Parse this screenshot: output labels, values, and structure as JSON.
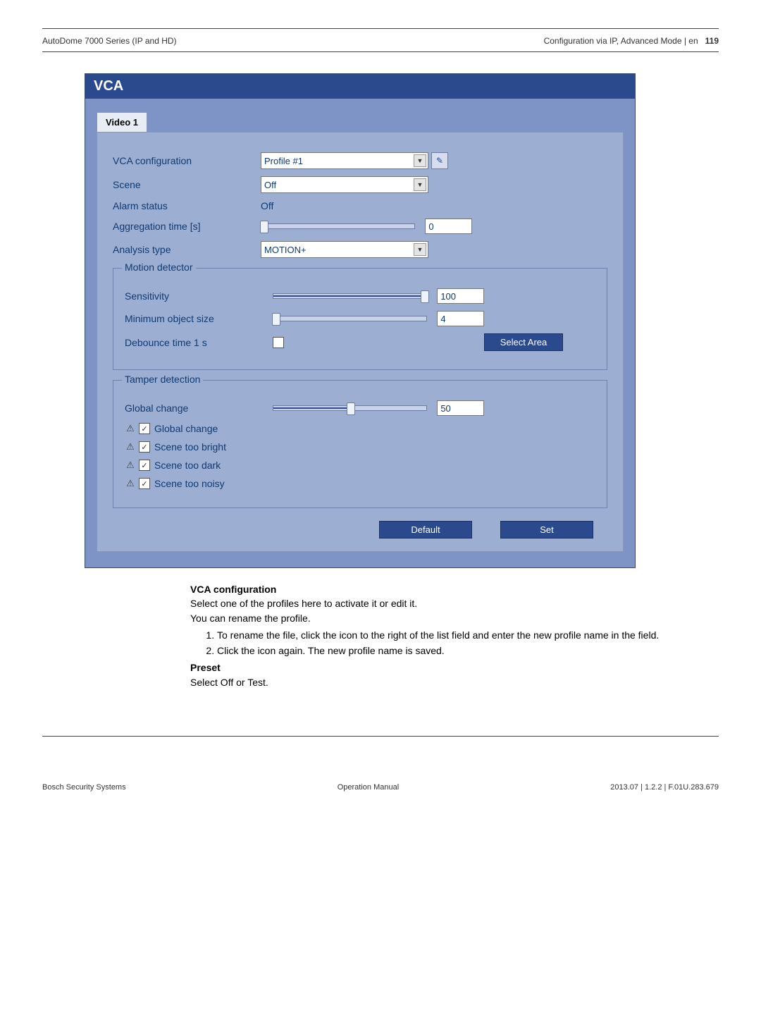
{
  "header": {
    "product": "AutoDome 7000 Series (IP and HD)",
    "section": "Configuration via IP, Advanced Mode | en",
    "page": "119"
  },
  "panel": {
    "title": "VCA",
    "tab": "Video 1",
    "rows": {
      "vca_config": {
        "label": "VCA configuration",
        "value": "Profile #1"
      },
      "scene": {
        "label": "Scene",
        "value": "Off"
      },
      "alarm_status": {
        "label": "Alarm status",
        "value": "Off"
      },
      "aggregation": {
        "label": "Aggregation time [s]",
        "value": "0"
      },
      "analysis_type": {
        "label": "Analysis type",
        "value": "MOTION+"
      }
    },
    "motion": {
      "title": "Motion detector",
      "sensitivity": {
        "label": "Sensitivity",
        "value": "100"
      },
      "min_obj": {
        "label": "Minimum object size",
        "value": "4"
      },
      "debounce": {
        "label": "Debounce time 1 s",
        "button": "Select Area"
      }
    },
    "tamper": {
      "title": "Tamper detection",
      "global_change_slider": {
        "label": "Global change",
        "value": "50"
      },
      "checks": [
        "Global change",
        "Scene too bright",
        "Scene too dark",
        "Scene too noisy"
      ]
    },
    "buttons": {
      "default": "Default",
      "set": "Set"
    }
  },
  "body": {
    "h1": "VCA configuration",
    "p1": "Select one of the profiles here to activate it or edit it.",
    "p2": "You can rename the profile.",
    "step1": "To rename the file, click the icon to the right of the list field and enter the new profile name in the field.",
    "step2": "Click the icon again. The new profile name is saved.",
    "h2": "Preset",
    "p3": "Select Off or Test."
  },
  "footer": {
    "left": "Bosch Security Systems",
    "center": "Operation Manual",
    "right": "2013.07 | 1.2.2 | F.01U.283.679"
  }
}
